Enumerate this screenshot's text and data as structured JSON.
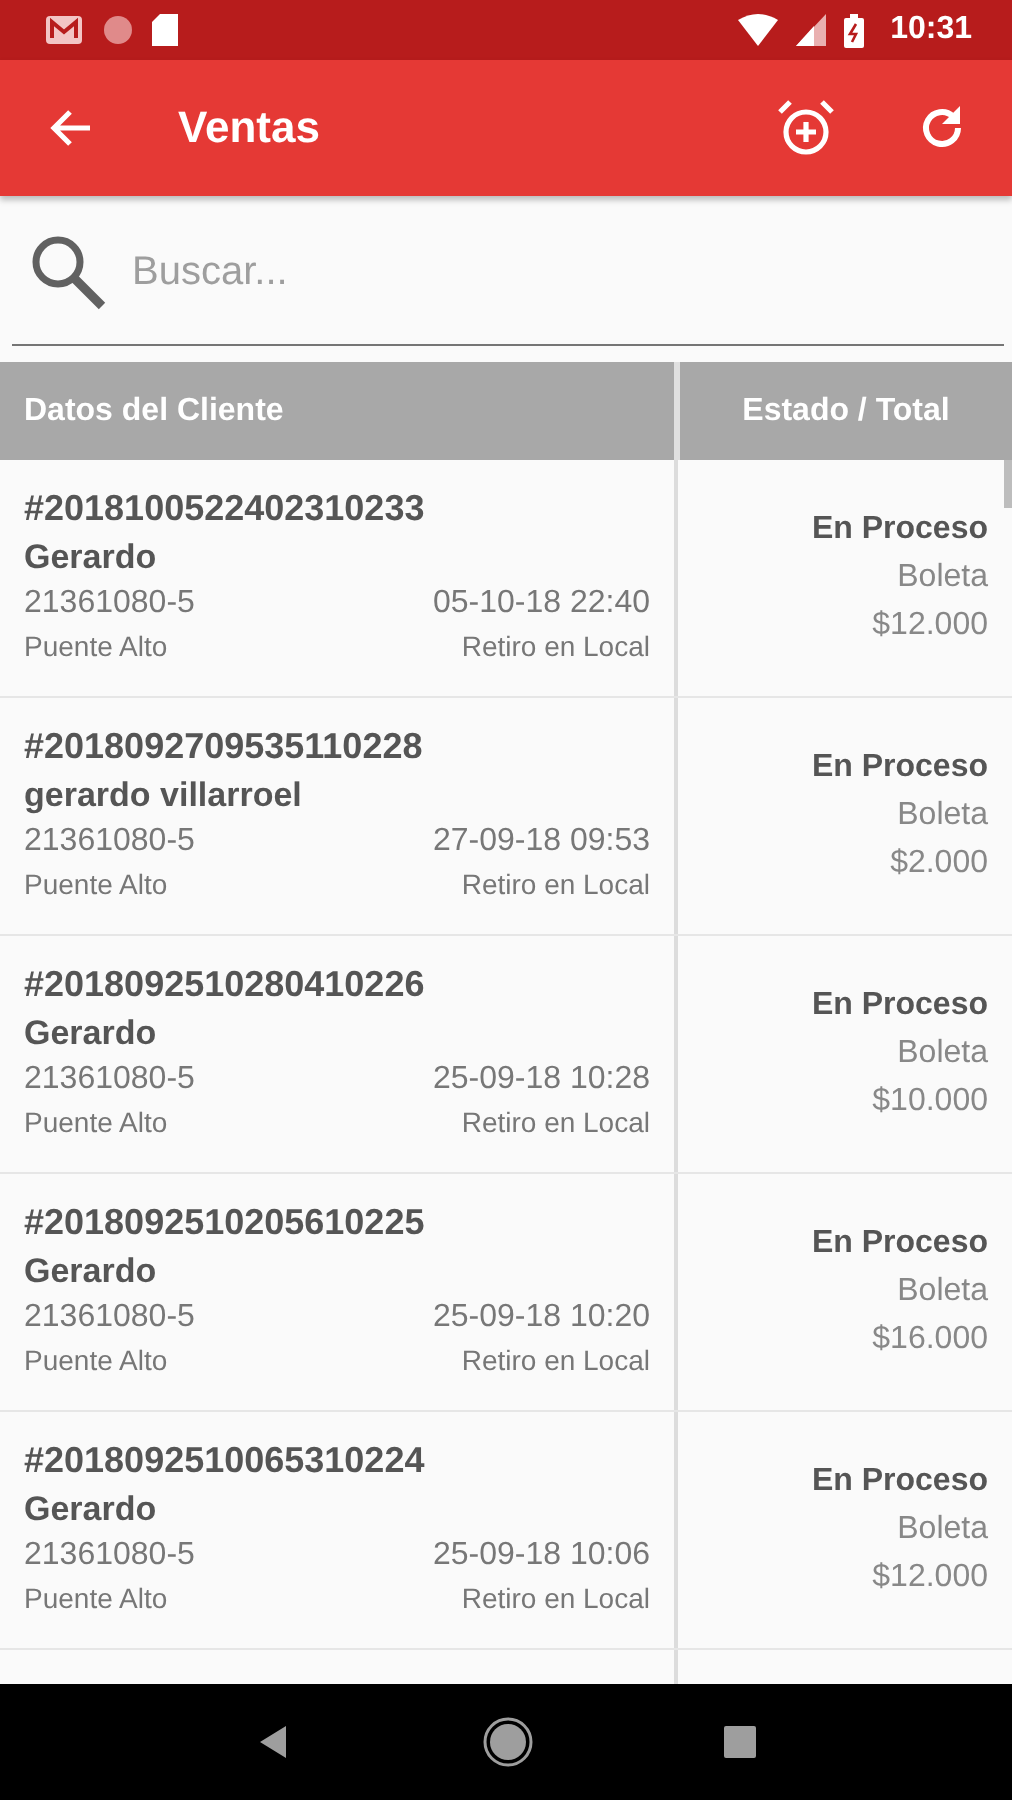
{
  "status_bar": {
    "time": "10:31"
  },
  "app_bar": {
    "title": "Ventas"
  },
  "search": {
    "placeholder": "Buscar..."
  },
  "table": {
    "columns": [
      "Datos del Cliente",
      "Estado / Total"
    ],
    "rows": [
      {
        "order": "#2018100522402310233",
        "name": "Gerardo",
        "rut": "21361080-5",
        "date": "05-10-18 22:40",
        "commune": "Puente Alto",
        "delivery": "Retiro en Local",
        "status": "En Proceso",
        "document": "Boleta",
        "total": "$12.000"
      },
      {
        "order": "#2018092709535110228",
        "name": "gerardo villarroel",
        "rut": "21361080-5",
        "date": "27-09-18 09:53",
        "commune": "Puente Alto",
        "delivery": "Retiro en Local",
        "status": "En Proceso",
        "document": "Boleta",
        "total": "$2.000"
      },
      {
        "order": "#2018092510280410226",
        "name": "Gerardo",
        "rut": "21361080-5",
        "date": "25-09-18 10:28",
        "commune": "Puente Alto",
        "delivery": "Retiro en Local",
        "status": "En Proceso",
        "document": "Boleta",
        "total": "$10.000"
      },
      {
        "order": "#2018092510205610225",
        "name": "Gerardo",
        "rut": "21361080-5",
        "date": "25-09-18 10:20",
        "commune": "Puente Alto",
        "delivery": "Retiro en Local",
        "status": "En Proceso",
        "document": "Boleta",
        "total": "$16.000"
      },
      {
        "order": "#2018092510065310224",
        "name": "Gerardo",
        "rut": "21361080-5",
        "date": "25-09-18 10:06",
        "commune": "Puente Alto",
        "delivery": "Retiro en Local",
        "status": "En Proceso",
        "document": "Boleta",
        "total": "$12.000"
      }
    ]
  }
}
